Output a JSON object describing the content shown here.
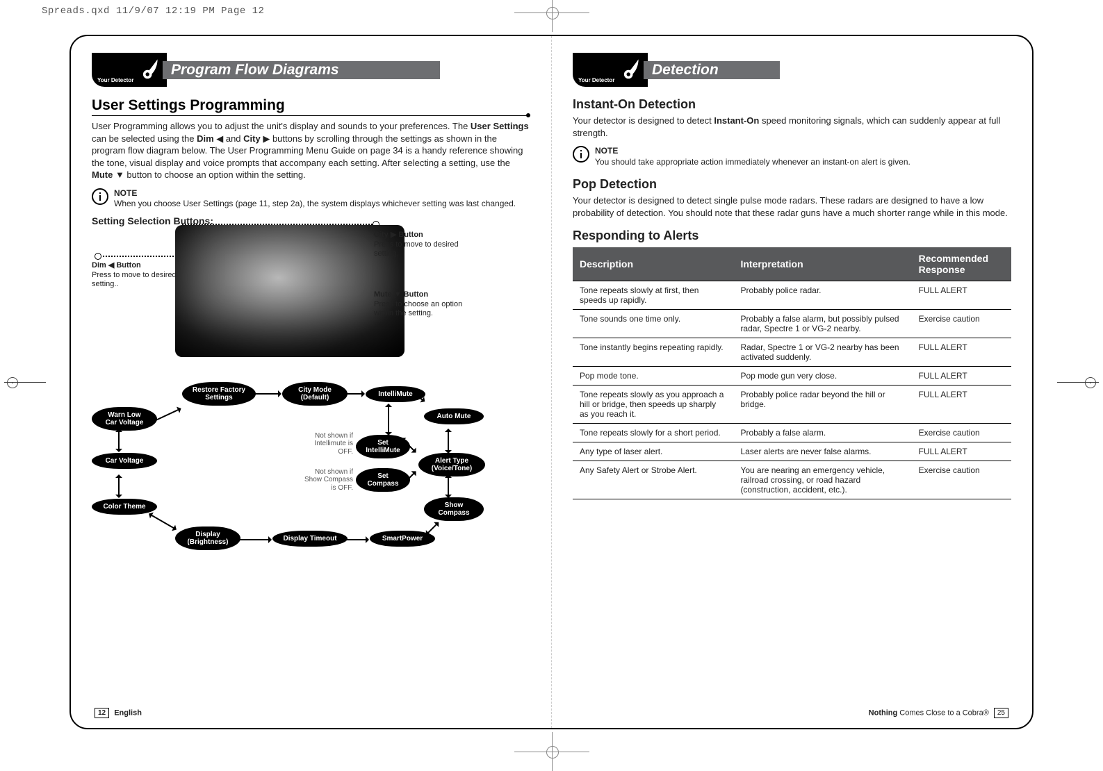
{
  "slug": "Spreads.qxd  11/9/07  12:19 PM  Page 12",
  "left": {
    "header": {
      "badge": "Your Detector",
      "title": "Program Flow Diagrams"
    },
    "h2": "User Settings Programming",
    "intro": "User Programming allows you to adjust the unit's display and sounds to your preferences. The <b>User Settings</b> can be selected using the <b>Dim</b> ◀ and <b>City</b> ▶ buttons by scrolling through the settings as shown in the program flow diagram below. The User Programming Menu Guide on page 34 is a handy reference showing the tone, visual display and voice prompts that accompany each setting. After selecting a setting, use the <b>Mute</b> ▼ button to choose an option within the setting.",
    "note": {
      "label": "NOTE",
      "text": "When you choose User Settings (page 11, step 2a), the system displays whichever setting was last changed."
    },
    "buttons_title": "Setting Selection Buttons:",
    "callouts": {
      "dim": {
        "title": "Dim ◀ Button",
        "text": "Press to move to desired setting.."
      },
      "city": {
        "title": "City ▶ Button",
        "text": "Press to move to desired setting."
      },
      "mute": {
        "title": "Mute ▼ Button",
        "text": "Press to choose an option within the setting."
      }
    },
    "flow": {
      "nodes": {
        "restore": "Restore Factory\nSettings",
        "citymode": "City Mode\n(Default)",
        "intelli": "IntelliMute",
        "automute": "Auto Mute",
        "setintelli": "Set\nIntelliMute",
        "alerttype": "Alert Type\n(Voice/Tone)",
        "setcomp": "Set\nCompass",
        "showcomp": "Show\nCompass",
        "warnlow": "Warn Low\nCar Voltage",
        "carv": "Car Voltage",
        "color": "Color Theme",
        "bright": "Display\n(Brightness)",
        "timeout": "Display Timeout",
        "smart": "SmartPower"
      },
      "notes": {
        "intelli_off": "Not shown\nif Intellimute\nis OFF.",
        "compass_off": "Not shown if\nShow Compass\nis OFF."
      }
    },
    "footer": {
      "pagenum": "12",
      "lang": "English"
    }
  },
  "right": {
    "header": {
      "badge": "Your Detector",
      "title": "Detection"
    },
    "h3_instant": "Instant-On Detection",
    "p_instant": "Your detector is designed to detect <b>Instant-On</b> speed monitoring signals, which can suddenly appear at full strength.",
    "note": {
      "label": "NOTE",
      "text": "You should take appropriate action immediately whenever an instant-on alert is given."
    },
    "h3_pop": "Pop Detection",
    "p_pop": "Your detector is designed to detect single pulse mode radars. These radars are designed to have a low probability of detection. You should note that these radar guns have a much shorter range while in this mode.",
    "h3_respond": "Responding to Alerts",
    "table": {
      "headers": [
        "Description",
        "Interpretation",
        "Recommended Response"
      ],
      "rows": [
        [
          "Tone repeats slowly at first, then speeds up rapidly.",
          "Probably police radar.",
          "FULL ALERT"
        ],
        [
          "Tone sounds one time only.",
          "Probably a false alarm, but possibly pulsed radar, Spectre 1 or VG-2 nearby.",
          "Exercise caution"
        ],
        [
          "Tone instantly begins repeating rapidly.",
          "Radar, Spectre 1 or VG-2 nearby has been activated suddenly.",
          "FULL ALERT"
        ],
        [
          "Pop mode tone.",
          "Pop mode gun very close.",
          "FULL ALERT"
        ],
        [
          "Tone repeats slowly as you approach a hill or bridge, then speeds up sharply as you reach it.",
          "Probably police radar beyond the hill or bridge.",
          "FULL ALERT"
        ],
        [
          "Tone repeats slowly for a short period.",
          "Probably a false alarm.",
          "Exercise caution"
        ],
        [
          "Any type of laser alert.",
          "Laser alerts are never false alarms.",
          "FULL ALERT"
        ],
        [
          "Any Safety Alert or Strobe Alert.",
          "You are nearing an emergency vehicle, railroad crossing, or road hazard (construction, accident, etc.).",
          "Exercise caution"
        ]
      ]
    },
    "footer": {
      "tagline_pre": "Nothing",
      "tagline_post": " Comes Close to a Cobra®",
      "pagenum": "25"
    }
  }
}
